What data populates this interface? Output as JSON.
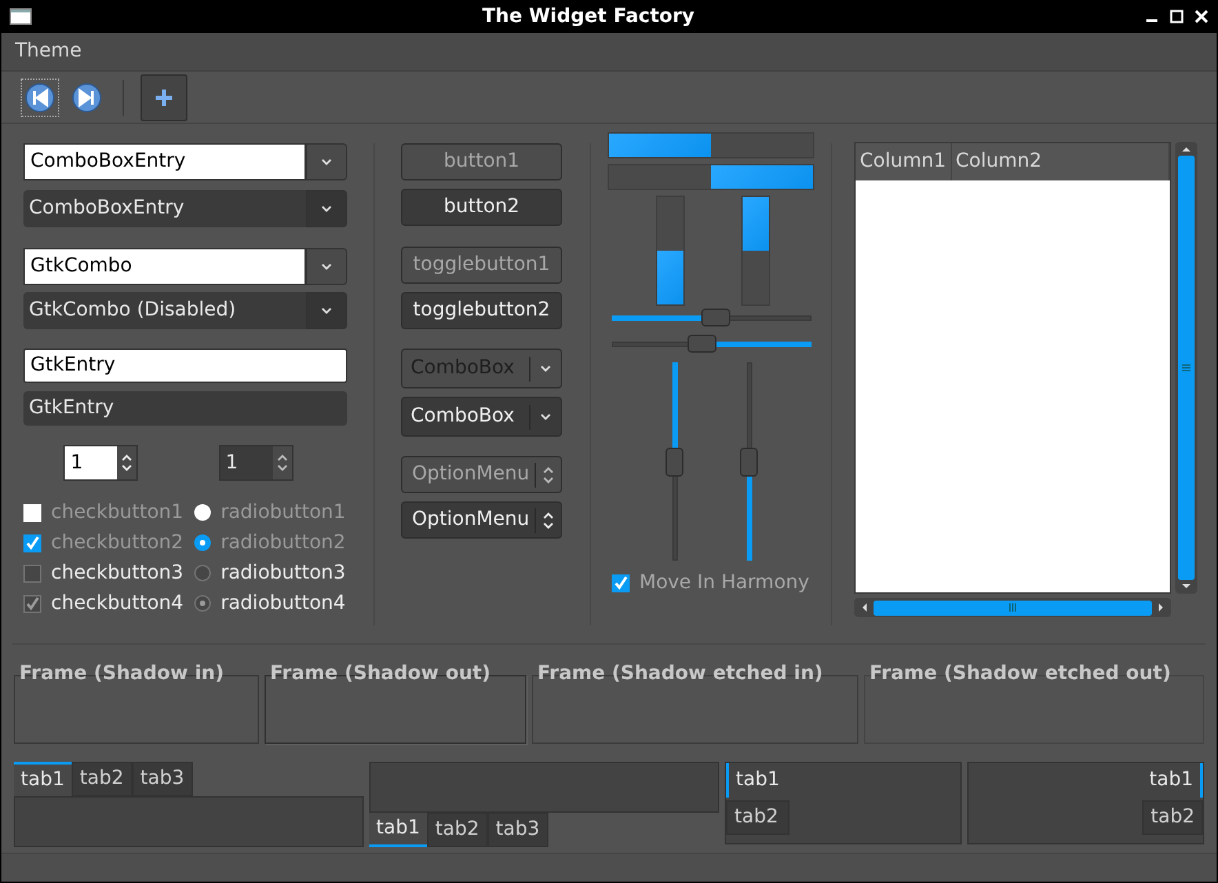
{
  "window": {
    "title": "The Widget Factory"
  },
  "menubar": [
    "Theme"
  ],
  "toolbar": [
    {
      "kind": "back",
      "focused": true,
      "pressed": false
    },
    {
      "kind": "forward",
      "focused": false,
      "pressed": false
    },
    {
      "kind": "separator"
    },
    {
      "kind": "add",
      "focused": false,
      "pressed": true
    }
  ],
  "combo_entries": [
    {
      "value": "ComboBoxEntry",
      "disabled": false
    },
    {
      "value": "ComboBoxEntry",
      "disabled": true
    }
  ],
  "gtk_combos": [
    {
      "value": "GtkCombo",
      "disabled": false
    },
    {
      "value": "GtkCombo (Disabled)",
      "disabled": true
    }
  ],
  "entries": [
    {
      "value": "GtkEntry",
      "disabled": false
    },
    {
      "value": "GtkEntry",
      "disabled": true
    }
  ],
  "spin_buttons": [
    {
      "value": "1",
      "disabled": false
    },
    {
      "value": "1",
      "disabled": true
    }
  ],
  "check_buttons": [
    {
      "label": "checkbutton1",
      "checked": false,
      "disabled": false
    },
    {
      "label": "checkbutton2",
      "checked": true,
      "disabled": false
    },
    {
      "label": "checkbutton3",
      "checked": false,
      "disabled": true
    },
    {
      "label": "checkbutton4",
      "checked": true,
      "disabled": true
    }
  ],
  "radio_buttons": [
    {
      "label": "radiobutton1",
      "selected": false,
      "disabled": false
    },
    {
      "label": "radiobutton2",
      "selected": true,
      "disabled": false
    },
    {
      "label": "radiobutton3",
      "selected": false,
      "disabled": true
    },
    {
      "label": "radiobutton4",
      "selected": true,
      "disabled": true
    }
  ],
  "buttons": [
    {
      "label": "button1",
      "disabled": true
    },
    {
      "label": "button2",
      "disabled": false
    }
  ],
  "toggle_buttons": [
    {
      "label": "togglebutton1",
      "disabled": true
    },
    {
      "label": "togglebutton2",
      "disabled": false
    }
  ],
  "combo_boxes": [
    {
      "label": "ComboBox",
      "disabled": true
    },
    {
      "label": "ComboBox",
      "disabled": false
    }
  ],
  "option_menus": [
    {
      "label": "OptionMenu",
      "disabled": true
    },
    {
      "label": "OptionMenu",
      "disabled": false
    }
  ],
  "progress_bars": [
    {
      "level": 0.5,
      "inverted": false
    },
    {
      "level": 0.5,
      "inverted": true
    }
  ],
  "vertical_progress_bars": [
    {
      "level": 0.5,
      "inverted": false
    },
    {
      "level": 0.5,
      "inverted": true
    }
  ],
  "scales": [
    {
      "level": 0.52,
      "inverted": false
    },
    {
      "level": 0.45,
      "inverted": true
    }
  ],
  "vertical_scales": [
    {
      "level": 0.5,
      "inverted": false
    },
    {
      "level": 0.5,
      "inverted": true
    }
  ],
  "move_in_harmony": {
    "label": "Move In Harmony",
    "checked": true
  },
  "tree_view": {
    "columns": [
      "Column1",
      "Column2"
    ]
  },
  "frames": [
    {
      "label": "Frame (Shadow in)",
      "kind": "in"
    },
    {
      "label": "Frame (Shadow out)",
      "kind": "out"
    },
    {
      "label": "Frame (Shadow etched in)",
      "kind": "etched_in"
    },
    {
      "label": "Frame (Shadow etched out)",
      "kind": "etched_out"
    }
  ],
  "notebooks": [
    {
      "kind": "top",
      "tabs": [
        {
          "label": "tab1",
          "selected": true
        },
        {
          "label": "tab2",
          "selected": false
        },
        {
          "label": "tab3",
          "selected": false
        }
      ]
    },
    {
      "kind": "bottom",
      "tabs": [
        {
          "label": "tab1",
          "selected": true
        },
        {
          "label": "tab2",
          "selected": false
        },
        {
          "label": "tab3",
          "selected": false
        }
      ]
    },
    {
      "kind": "left",
      "tabs": [
        {
          "label": "tab1",
          "selected": true
        },
        {
          "label": "tab2",
          "selected": false
        }
      ]
    },
    {
      "kind": "right",
      "tabs": [
        {
          "label": "tab1",
          "selected": true
        },
        {
          "label": "tab2",
          "selected": false
        }
      ]
    }
  ]
}
